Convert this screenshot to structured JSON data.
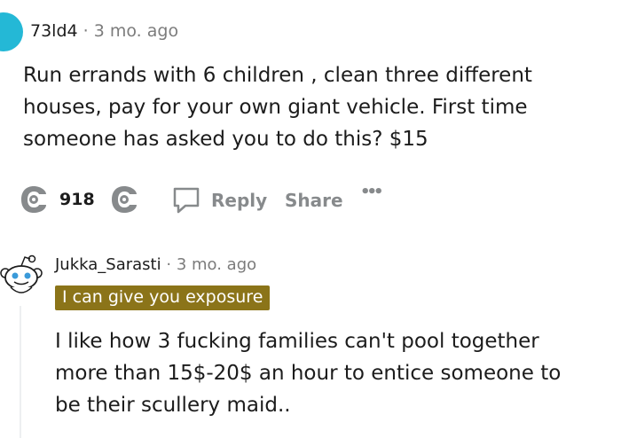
{
  "comment1": {
    "username": "73ld4",
    "separator": "·",
    "time": "3 mo. ago",
    "lines": [
      "Run errands with 6 children , clean three different",
      "houses, pay for your own giant vehicle. First time",
      "someone has asked you to do this? $15"
    ],
    "score": "918",
    "reply_label": "Reply",
    "share_label": "Share",
    "more_label": "•••"
  },
  "comment2": {
    "username": "Jukka_Sarasti",
    "separator": "·",
    "time": "3 mo. ago",
    "flair": "I can give you exposure",
    "lines": [
      "I like how 3 fucking families can't pool together",
      "more than 15$-20$ an hour to entice someone to",
      "be their scullery maid.."
    ]
  },
  "colors": {
    "avatar1": "#24b8d6",
    "flair_bg": "#8b7419",
    "vote_icon": "#878a8c",
    "action_text": "#878a8c"
  },
  "icons": {
    "upvote": "upvote-award-icon",
    "downvote": "downvote-award-icon",
    "reply": "speech-bubble-icon",
    "avatar2": "snoo-avatar-icon"
  }
}
